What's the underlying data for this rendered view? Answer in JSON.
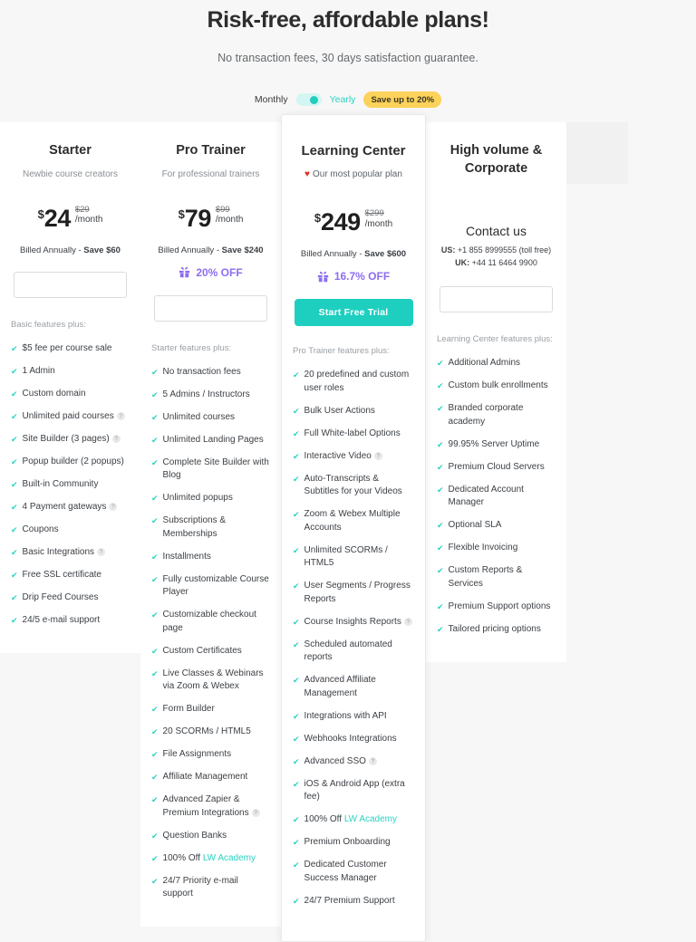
{
  "header": {
    "title": "Risk-free, affordable plans!",
    "subtitle": "No transaction fees, 30 days satisfaction guarantee."
  },
  "billing": {
    "monthly_label": "Monthly",
    "yearly_label": "Yearly",
    "save_badge": "Save up to 20%",
    "selected": "Yearly",
    "toggle_icon": "toggle-switch-on",
    "badge_color": "#fcd25a",
    "accent_color": "#2ad2c1"
  },
  "icons": {
    "check": "check-icon",
    "info": "info-icon",
    "heart": "heart-icon",
    "gift": "gift-icon"
  },
  "plans": [
    {
      "name": "Starter",
      "tagline": "Newbie course creators",
      "currency": "$",
      "amount": "24",
      "old_price": "$29",
      "per": "/month",
      "billed_note_prefix": "Billed Annually - ",
      "billed_note_strong": "Save $60",
      "cta_label": "",
      "cta_style": "outline",
      "features_head": "Basic features plus:",
      "features": [
        {
          "text": "$5 fee per course sale",
          "info": false
        },
        {
          "text": "1 Admin",
          "info": false
        },
        {
          "text": "Custom domain",
          "info": false
        },
        {
          "text": "Unlimited paid courses",
          "info": true
        },
        {
          "text": "Site Builder (3 pages)",
          "info": true
        },
        {
          "text": "Popup builder (2 popups)",
          "info": false
        },
        {
          "text": "Built-in Community",
          "info": false
        },
        {
          "text": "4 Payment gateways",
          "info": true
        },
        {
          "text": "Coupons",
          "info": false
        },
        {
          "text": "Basic Integrations",
          "info": true
        },
        {
          "text": "Free SSL certificate",
          "info": false
        },
        {
          "text": "Drip Feed Courses",
          "info": false
        },
        {
          "text": "24/5 e-mail support",
          "info": false
        }
      ]
    },
    {
      "name": "Pro Trainer",
      "tagline": "For professional trainers",
      "currency": "$",
      "amount": "79",
      "old_price": "$99",
      "per": "/month",
      "billed_note_prefix": "Billed Annually - ",
      "billed_note_strong": "Save $240",
      "discount_label": "20% OFF",
      "cta_label": "",
      "cta_style": "outline",
      "features_head": "Starter features plus:",
      "features": [
        {
          "text": "No transaction fees",
          "info": false
        },
        {
          "text": "5 Admins / Instructors",
          "info": false
        },
        {
          "text": "Unlimited courses",
          "info": false
        },
        {
          "text": "Unlimited Landing Pages",
          "info": false
        },
        {
          "text": "Complete Site Builder with Blog",
          "info": false
        },
        {
          "text": "Unlimited popups",
          "info": false
        },
        {
          "text": "Subscriptions & Memberships",
          "info": false
        },
        {
          "text": "Installments",
          "info": false
        },
        {
          "text": "Fully customizable Course Player",
          "info": false
        },
        {
          "text": "Customizable checkout page",
          "info": false
        },
        {
          "text": "Custom Certificates",
          "info": false
        },
        {
          "text": "Live Classes & Webinars via Zoom & Webex",
          "info": false
        },
        {
          "text": "Form Builder",
          "info": false
        },
        {
          "text": "20 SCORMs / HTML5",
          "info": false
        },
        {
          "text": "File Assignments",
          "info": false
        },
        {
          "text": "Affiliate Management",
          "info": false
        },
        {
          "text": "Advanced Zapier & Premium Integrations",
          "info": true
        },
        {
          "text": "Question Banks",
          "info": false
        },
        {
          "text": "100% Off ",
          "link": "LW Academy",
          "info": false
        },
        {
          "text": "24/7 Priority e-mail support",
          "info": false
        }
      ]
    },
    {
      "name": "Learning Center",
      "tagline": "Our most popular plan",
      "featured": true,
      "currency": "$",
      "amount": "249",
      "old_price": "$299",
      "per": "/month",
      "billed_note_prefix": "Billed Annually - ",
      "billed_note_strong": "Save $600",
      "discount_label": "16.7% OFF",
      "cta_label": "Start Free Trial",
      "cta_style": "solid",
      "features_head": "Pro Trainer features plus:",
      "features": [
        {
          "text": "20 predefined and custom user roles",
          "info": false
        },
        {
          "text": "Bulk User Actions",
          "info": false
        },
        {
          "text": "Full White-label Options",
          "info": false
        },
        {
          "text": "Interactive Video",
          "info": true
        },
        {
          "text": "Auto-Transcripts & Subtitles for your Videos",
          "info": false
        },
        {
          "text": "Zoom & Webex Multiple Accounts",
          "info": false
        },
        {
          "text": "Unlimited SCORMs / HTML5",
          "info": false
        },
        {
          "text": "User Segments / Progress Reports",
          "info": false
        },
        {
          "text": "Course Insights Reports",
          "info": true
        },
        {
          "text": "Scheduled automated reports",
          "info": false
        },
        {
          "text": "Advanced Affiliate Management",
          "info": false
        },
        {
          "text": "Integrations with API",
          "info": false
        },
        {
          "text": "Webhooks Integrations",
          "info": false
        },
        {
          "text": "Advanced SSO",
          "info": true
        },
        {
          "text": "iOS & Android App (extra fee)",
          "info": false
        },
        {
          "text": "100% Off ",
          "link": "LW Academy",
          "info": false
        },
        {
          "text": "Premium Onboarding",
          "info": false
        },
        {
          "text": "Dedicated Customer Success Manager",
          "info": false
        },
        {
          "text": "24/7 Premium Support",
          "info": false
        }
      ]
    },
    {
      "name": "High volume & Corporate",
      "tagline": "",
      "contact_title": "Contact us",
      "contact_us_label": "US:",
      "contact_us_value": "+1 855 8999555 (toll free)",
      "contact_uk_label": "UK:",
      "contact_uk_value": "+44 11 6464 9900",
      "cta_label": "",
      "cta_style": "outline",
      "features_head": "Learning Center features plus:",
      "features": [
        {
          "text": "Additional Admins",
          "info": false
        },
        {
          "text": "Custom bulk enrollments",
          "info": false
        },
        {
          "text": "Branded corporate academy",
          "info": false
        },
        {
          "text": "99.95% Server Uptime",
          "info": false
        },
        {
          "text": "Premium Cloud Servers",
          "info": false
        },
        {
          "text": "Dedicated Account Manager",
          "info": false
        },
        {
          "text": "Optional SLA",
          "info": false
        },
        {
          "text": "Flexible Invoicing",
          "info": false
        },
        {
          "text": "Custom Reports & Services",
          "info": false
        },
        {
          "text": "Premium Support options",
          "info": false
        },
        {
          "text": "Tailored pricing options",
          "info": false
        }
      ]
    }
  ]
}
